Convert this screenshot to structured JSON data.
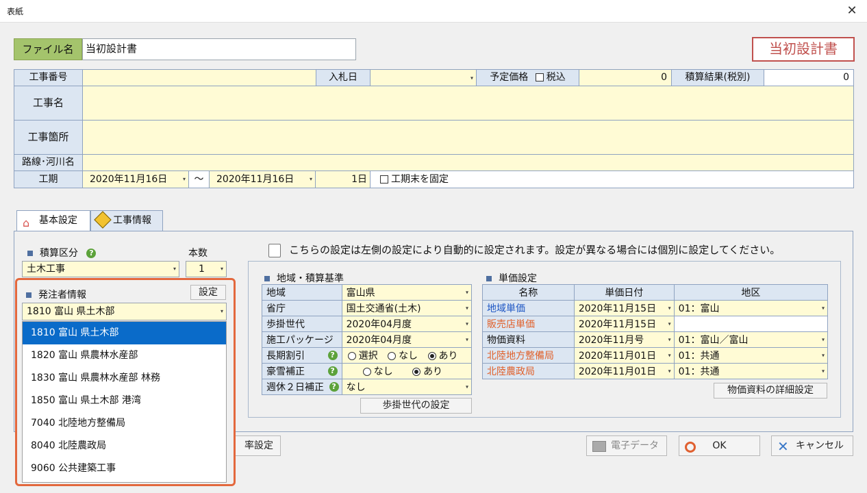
{
  "window": {
    "title": "表紙"
  },
  "file": {
    "label": "ファイル名",
    "value": "当初設計書",
    "stamp": "当初設計書"
  },
  "header": {
    "koji_bango_label": "工事番号",
    "nyusatsu_label": "入札日",
    "yotei_label": "予定価格",
    "zeikomi_label": "税込",
    "yotei_value": "0",
    "sekisan_label": "積算結果(税別)",
    "sekisan_value": "0",
    "koji_mei_label": "工事名",
    "koji_kasho_label": "工事箇所",
    "rosen_label": "路線･河川名",
    "koki_label": "工期",
    "koki_start": "2020年11月16日",
    "koki_tilde": "〜",
    "koki_end": "2020年11月16日",
    "koki_days": "1日",
    "koki_fix_label": "工期末を固定"
  },
  "tabs": [
    {
      "label": "基本設定"
    },
    {
      "label": "工事情報"
    }
  ],
  "basic": {
    "sekisan_kubun_label": "積算区分",
    "honsu_label": "本数",
    "sekisan_kubun_value": "土木工事",
    "honsu_value": "1",
    "hacchu_label": "発注者情報",
    "settei_button": "設定",
    "hacchu_value": "1810 富山 県土木部",
    "notice": "こちらの設定は左側の設定により自動的に設定されます。設定が異なる場合には個別に設定してください。",
    "ritsu_button_partial": "率設定"
  },
  "dropdown_items": [
    "1810 富山 県土木部",
    "1820 富山 県農林水産部",
    "1830 富山 県農林水産部 林務",
    "1850 富山 県土木部 港湾",
    "7040 北陸地方整備局",
    "8040 北陸農政局",
    "9060 公共建築工事"
  ],
  "region": {
    "title": "地域・積算基準",
    "rows": [
      {
        "label": "地域",
        "value": "富山県"
      },
      {
        "label": "省庁",
        "value": "国土交通省(土木)"
      },
      {
        "label": "歩掛世代",
        "value": "2020年04月度"
      },
      {
        "label": "施工パッケージ",
        "value": "2020年04月度"
      }
    ],
    "choki_label": "長期割引",
    "choki_options": [
      "選択",
      "なし",
      "あり"
    ],
    "gosetsu_label": "豪雪補正",
    "gosetsu_options": [
      "なし",
      "あり"
    ],
    "shukyu_label": "週休２日補正",
    "shukyu_value": "なし",
    "bukake_button": "歩掛世代の設定"
  },
  "tanka": {
    "title": "単価設定",
    "headers": [
      "名称",
      "単価日付",
      "地区"
    ],
    "rows": [
      {
        "name": "地域単価",
        "date": "2020年11月15日",
        "area": "01：富山",
        "color": "#1f57c4"
      },
      {
        "name": "販売店単価",
        "date": "2020年11月15日",
        "area": "",
        "color": "#e0602a"
      },
      {
        "name": "物価資料",
        "date": "2020年11月号",
        "area": "01：富山／富山",
        "color": "#111111"
      },
      {
        "name": "北陸地方整備局",
        "date": "2020年11月01日",
        "area": "01：共通",
        "color": "#e0602a"
      },
      {
        "name": "北陸農政局",
        "date": "2020年11月01日",
        "area": "01：共通",
        "color": "#e0602a"
      }
    ],
    "detail_button": "物価資料の詳細設定"
  },
  "footer": {
    "denshi_label": "電子データ",
    "ok_label": "OK",
    "cancel_label": "キャンセル"
  }
}
